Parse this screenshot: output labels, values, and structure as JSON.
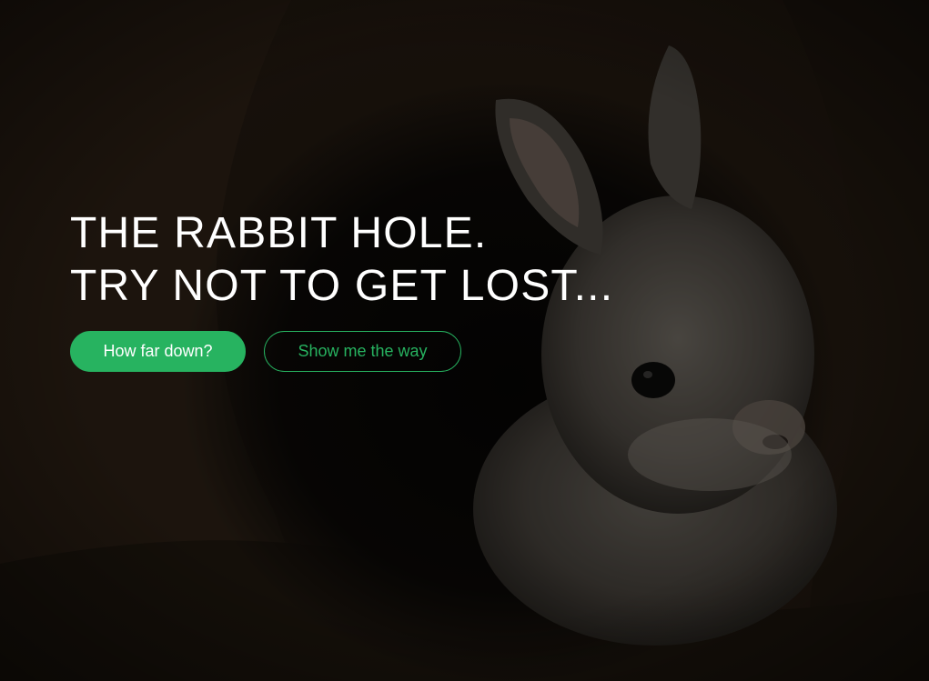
{
  "hero": {
    "headline_line1": "THE RABBIT HOLE.",
    "headline_line2": "TRY NOT TO GET LOST...",
    "primary_button": "How far down?",
    "secondary_button": "Show me the way",
    "background_image": "rabbit-in-burrow-photo"
  },
  "colors": {
    "accent": "#27b360",
    "headline_text": "#ffffff",
    "overlay": "#0d0a07"
  }
}
